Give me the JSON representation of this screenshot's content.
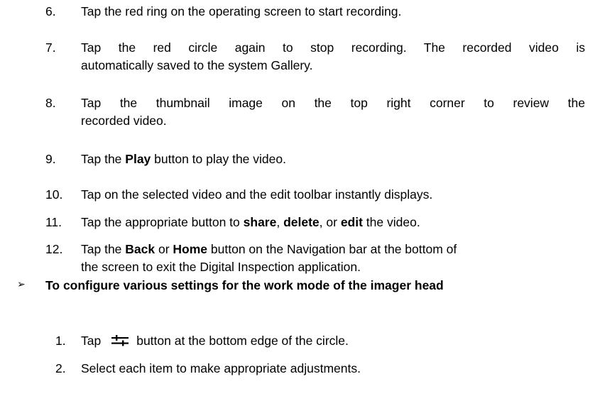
{
  "steps": [
    {
      "num": "6.",
      "text": "Tap the red ring on the operating screen to start recording."
    },
    {
      "num": "7.",
      "line1": "Tap the red circle again to stop recording. The recorded video is",
      "line2": "automatically saved to the system Gallery."
    },
    {
      "num": "8.",
      "line1": "Tap the thumbnail image on the top right corner to review the",
      "line2": "recorded video."
    },
    {
      "num": "9.",
      "pre": "Tap the ",
      "bold": "Play",
      "post": " button to play the video."
    },
    {
      "num": "10.",
      "text": "Tap on the selected video and the edit toolbar instantly displays."
    },
    {
      "num": "11.",
      "pre": "Tap the appropriate button to ",
      "b1": "share",
      "mid1": ", ",
      "b2": "delete",
      "mid2": ", or ",
      "b3": "edit",
      "post": " the video."
    },
    {
      "num": "12.",
      "pre": "Tap the ",
      "b1": "Back",
      "mid": " or ",
      "b2": "Home",
      "post": " button on the Navigation bar at the bottom of",
      "line2": "the screen to exit the Digital Inspection application."
    }
  ],
  "section": {
    "bullet": "➢",
    "heading": "To configure various settings for the work mode of the imager head",
    "steps": [
      {
        "num": "1.",
        "pre": "Tap",
        "icon": "sliders-icon",
        "post": "button at the bottom edge of the circle."
      },
      {
        "num": "2.",
        "text": "Select each item to make appropriate adjustments."
      }
    ]
  }
}
